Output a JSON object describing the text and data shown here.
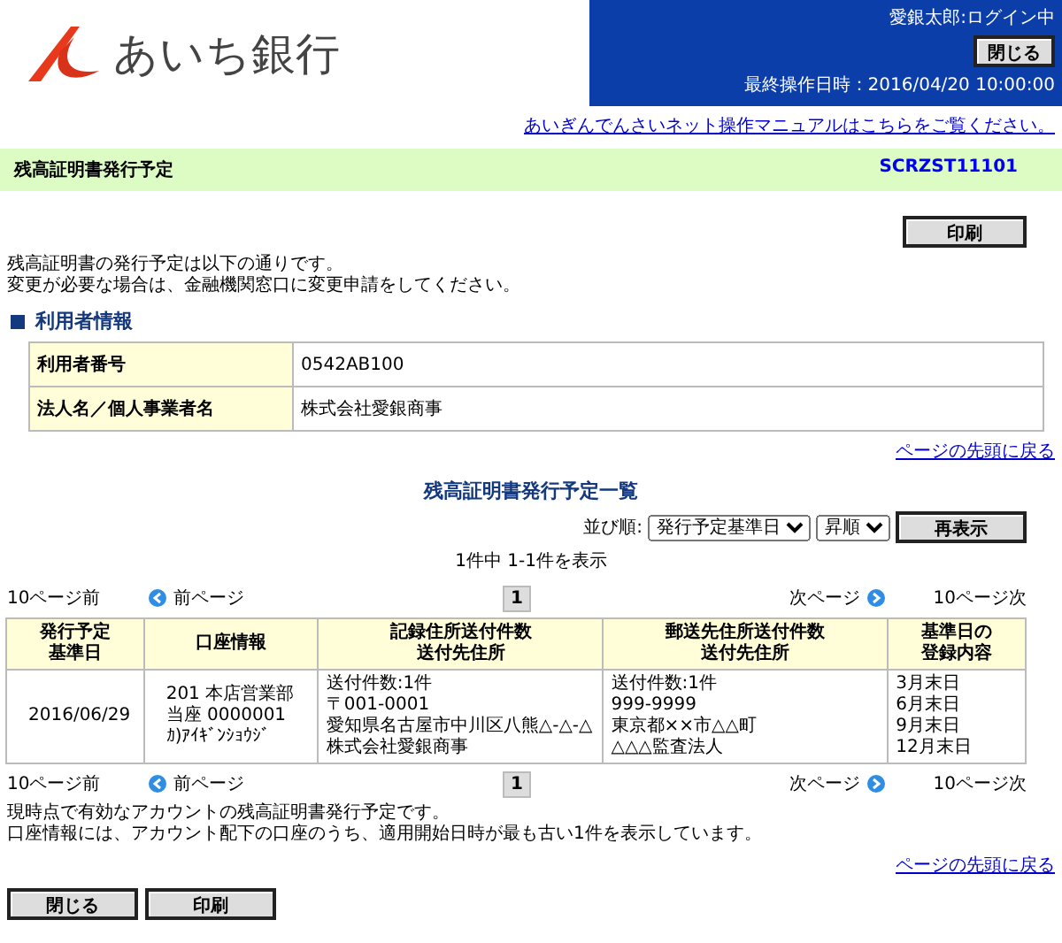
{
  "header": {
    "bank_name": "あいち銀行",
    "user_status": "愛銀太郎:ログイン中",
    "close_button": "閉じる",
    "last_operation": "最終操作日時：2016/04/20 10:00:00",
    "manual_link": "あいぎんでんさいネット操作マニュアルはこちらをご覧ください。"
  },
  "title_bar": {
    "title": "残高証明書発行予定",
    "screen_id": "SCRZST11101"
  },
  "print_button": "印刷",
  "intro": [
    "残高証明書の発行予定は以下の通りです。",
    "変更が必要な場合は、金融機関窓口に変更申請をしてください。"
  ],
  "user_info": {
    "heading": "利用者情報",
    "rows": [
      {
        "label": "利用者番号",
        "value": "0542AB100"
      },
      {
        "label": "法人名／個人事業者名",
        "value": "株式会社愛銀商事"
      }
    ],
    "top_link": "ページの先頭に戻る"
  },
  "list": {
    "title": "残高証明書発行予定一覧",
    "sort_label": "並び順:",
    "sort_field": "発行予定基準日",
    "sort_order": "昇順",
    "redisplay_button": "再表示",
    "count": "1件中 1-1件を表示",
    "pager_top": {
      "prev10": "10ページ前",
      "prev": "前ページ",
      "pages": [
        {
          "label": "1",
          "selected": true
        }
      ],
      "next": "次ページ",
      "next10": "10ページ次"
    },
    "columns": [
      {
        "lines": [
          "発行予定",
          "基準日"
        ]
      },
      {
        "lines": [
          "口座情報"
        ]
      },
      {
        "lines": [
          "記録住所送付件数",
          "送付先住所"
        ]
      },
      {
        "lines": [
          "郵送先住所送付件数",
          "送付先住所"
        ]
      },
      {
        "lines": [
          "基準日の",
          "登録内容"
        ]
      }
    ],
    "rows": [
      {
        "cells": [
          {
            "lines": [
              "2016/06/29"
            ]
          },
          {
            "lines": [
              "201 本店営業部",
              "当座 0000001",
              "ｶ)ｱｲｷﾞﾝｼｮｳｼﾞ"
            ]
          },
          {
            "lines": [
              "送付件数:1件",
              "〒001-0001",
              "愛知県名古屋市中川区八熊△-△-△",
              "株式会社愛銀商事"
            ]
          },
          {
            "lines": [
              "送付件数:1件",
              "999-9999",
              "東京都××市△△町",
              "△△△監査法人"
            ]
          },
          {
            "lines": [
              "3月末日",
              "6月末日",
              "9月末日",
              "12月末日"
            ]
          }
        ]
      }
    ],
    "pager_bottom": {
      "prev10": "10ページ前",
      "prev": "前ページ",
      "pages": [
        {
          "label": "1",
          "selected": true
        }
      ],
      "next": "次ページ",
      "next10": "10ページ次"
    }
  },
  "notes": [
    "現時点で有効なアカウントの残高証明書発行予定です。",
    "口座情報には、アカウント配下の口座のうち、適用開始日時が最も古い1件を表示しています。"
  ],
  "bottom_link": "ページの先頭に戻る",
  "footer_buttons": [
    "閉じる",
    "印刷"
  ]
}
